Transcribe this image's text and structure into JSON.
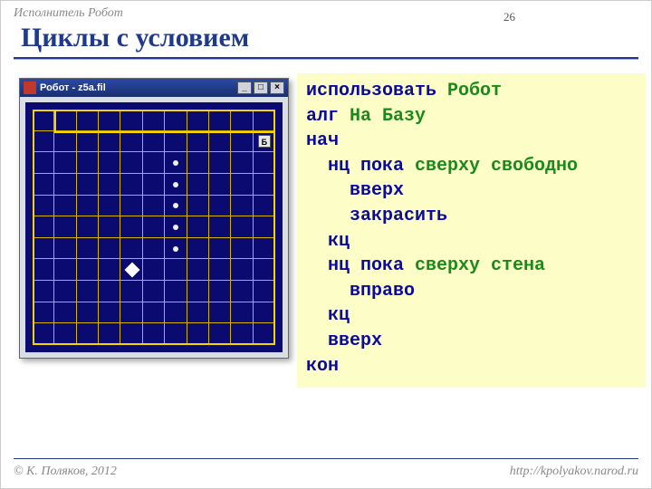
{
  "header": {
    "supertitle": "Исполнитель Робот",
    "title": "Циклы с условием",
    "page_number": "26"
  },
  "robot_window": {
    "title": "Робот - z5a.fil",
    "min_label": "_",
    "max_label": "□",
    "close_label": "×",
    "base_label": "Б",
    "grid": {
      "cols": 11,
      "rows": 11
    },
    "base_cell": {
      "col": 10,
      "row": 1
    },
    "robot_cell": {
      "col": 4,
      "row": 7
    },
    "painted_cells": [
      {
        "col": 6,
        "row": 2
      },
      {
        "col": 6,
        "row": 3
      },
      {
        "col": 6,
        "row": 4
      },
      {
        "col": 6,
        "row": 5
      },
      {
        "col": 6,
        "row": 6
      }
    ]
  },
  "code": {
    "lines": [
      {
        "tokens": [
          {
            "t": "использовать ",
            "c": "kw"
          },
          {
            "t": "Робот",
            "c": "id"
          }
        ]
      },
      {
        "tokens": [
          {
            "t": "алг ",
            "c": "kw"
          },
          {
            "t": "На Базу",
            "c": "id"
          }
        ]
      },
      {
        "tokens": [
          {
            "t": "нач",
            "c": "kw"
          }
        ]
      },
      {
        "tokens": [
          {
            "t": "  нц пока ",
            "c": "kw"
          },
          {
            "t": "сверху свободно",
            "c": "id"
          }
        ]
      },
      {
        "tokens": [
          {
            "t": "    вверх",
            "c": "kw"
          }
        ]
      },
      {
        "tokens": [
          {
            "t": "    закрасить",
            "c": "kw"
          }
        ]
      },
      {
        "tokens": [
          {
            "t": "  кц",
            "c": "kw"
          }
        ]
      },
      {
        "tokens": [
          {
            "t": "  нц пока ",
            "c": "kw"
          },
          {
            "t": "сверху стена",
            "c": "id"
          }
        ]
      },
      {
        "tokens": [
          {
            "t": "    вправо",
            "c": "kw"
          }
        ]
      },
      {
        "tokens": [
          {
            "t": "  кц",
            "c": "kw"
          }
        ]
      },
      {
        "tokens": [
          {
            "t": "  вверх",
            "c": "kw"
          }
        ]
      },
      {
        "tokens": [
          {
            "t": "кон",
            "c": "kw"
          }
        ]
      }
    ]
  },
  "footer": {
    "left": "© К. Поляков, 2012",
    "right": "http://kpolyakov.narod.ru"
  }
}
